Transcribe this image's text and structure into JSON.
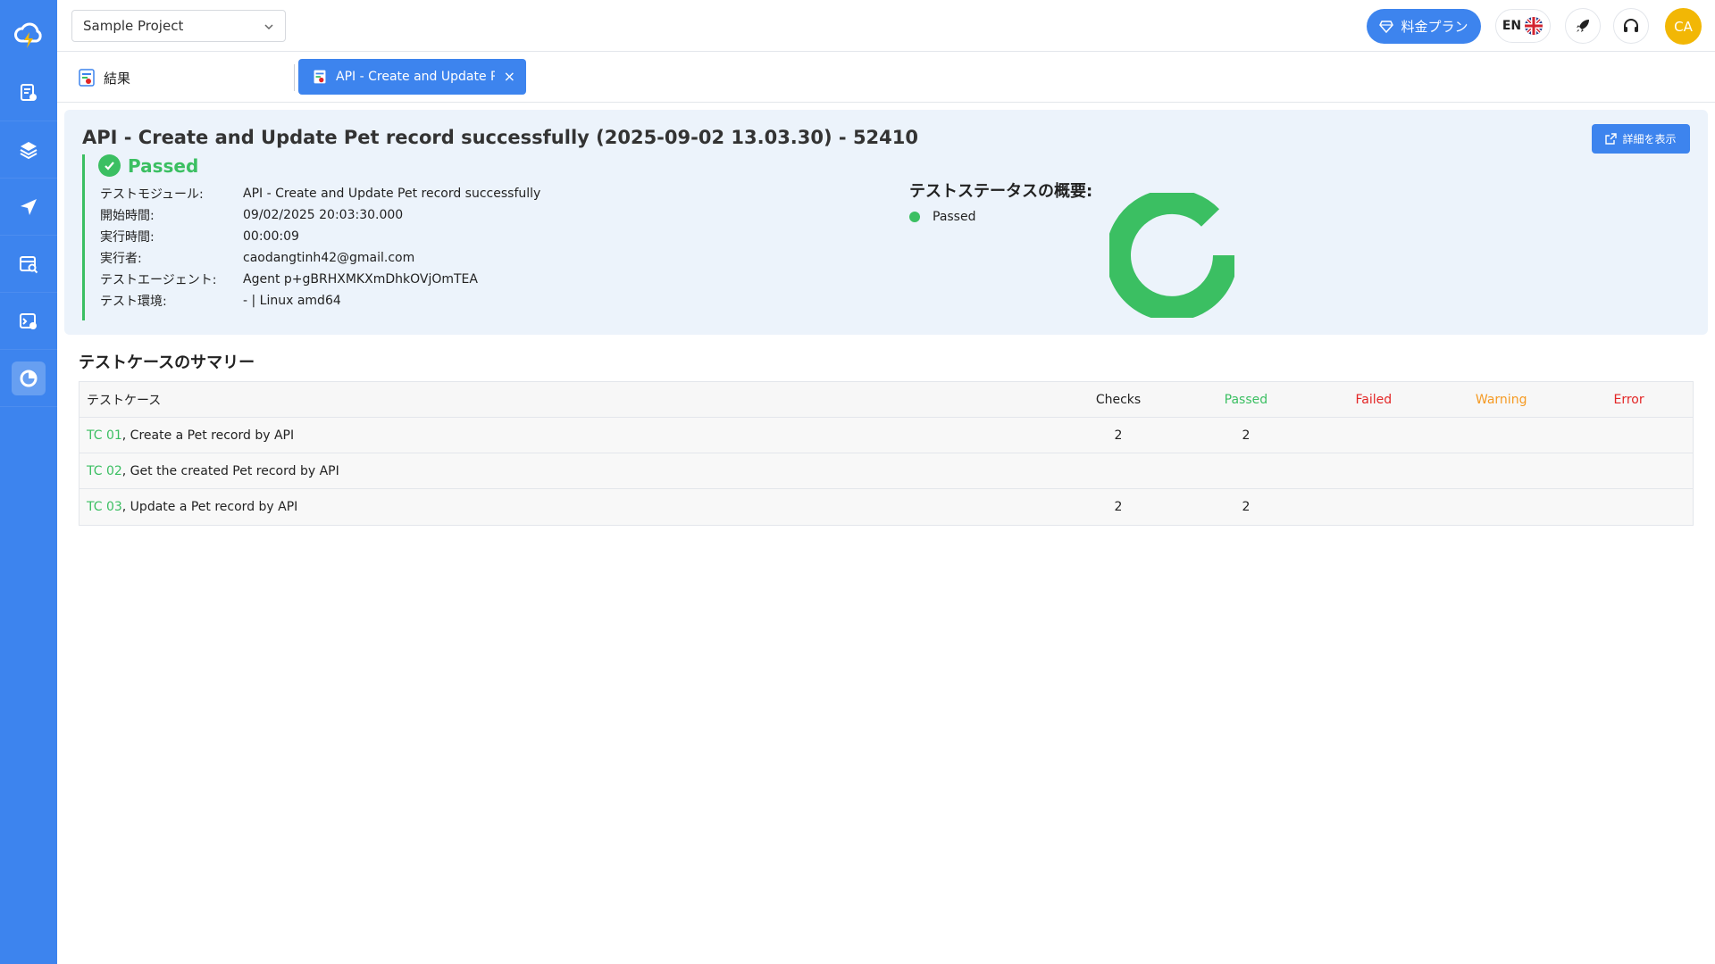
{
  "colors": {
    "primary": "#3d84ee",
    "passed": "#3bbf62",
    "failed": "#e32626",
    "warning": "#f59a23",
    "error": "#e32626",
    "avatar": "#f2b705"
  },
  "sidebar": {
    "items": [
      {
        "icon": "test-case-icon"
      },
      {
        "icon": "layers-icon"
      },
      {
        "icon": "send-icon"
      },
      {
        "icon": "calendar-search-icon"
      },
      {
        "icon": "terminal-settings-icon"
      },
      {
        "icon": "results-icon",
        "active": true
      }
    ]
  },
  "topbar": {
    "project": "Sample Project",
    "pricing_label": "料金プラン",
    "language": "EN",
    "avatar_initials": "CA"
  },
  "tabs": {
    "results_label": "結果",
    "active_label": "API - Create and Update P...",
    "close_symbol": "×"
  },
  "run": {
    "title": "API - Create and Update Pet record successfully (2025-09-02 13.03.30) - 52410",
    "status": "Passed",
    "details_button": "詳細を表示",
    "info": [
      {
        "label": "テストモジュール:",
        "value": "API - Create and Update Pet record successfully"
      },
      {
        "label": "開始時間:",
        "value": "09/02/2025 20:03:30.000"
      },
      {
        "label": "実行時間:",
        "value": "00:00:09"
      },
      {
        "label": "実行者:",
        "value": "caodangtinh42@gmail.com"
      },
      {
        "label": "テストエージェント:",
        "value": "Agent p+gBRHXMKXmDhkOVjOmTEA"
      },
      {
        "label": "テスト環境:",
        "value": "- | Linux amd64"
      }
    ],
    "overview_title": "テストステータスの概要:",
    "legend": [
      {
        "label": "Passed",
        "color": "#3bbf62"
      }
    ]
  },
  "summary": {
    "title": "テストケースのサマリー",
    "headers": {
      "testcase": "テストケース",
      "checks": "Checks",
      "passed": "Passed",
      "failed": "Failed",
      "warning": "Warning",
      "error": "Error"
    },
    "rows": [
      {
        "id": "TC 01",
        "name": ", Create a Pet record by API",
        "checks": "2",
        "passed": "2",
        "failed": "",
        "warning": "",
        "error": ""
      },
      {
        "id": "TC 02",
        "name": ", Get the created Pet record by API",
        "checks": "",
        "passed": "",
        "failed": "",
        "warning": "",
        "error": ""
      },
      {
        "id": "TC 03",
        "name": ", Update a Pet record by API",
        "checks": "2",
        "passed": "2",
        "failed": "",
        "warning": "",
        "error": ""
      }
    ]
  }
}
